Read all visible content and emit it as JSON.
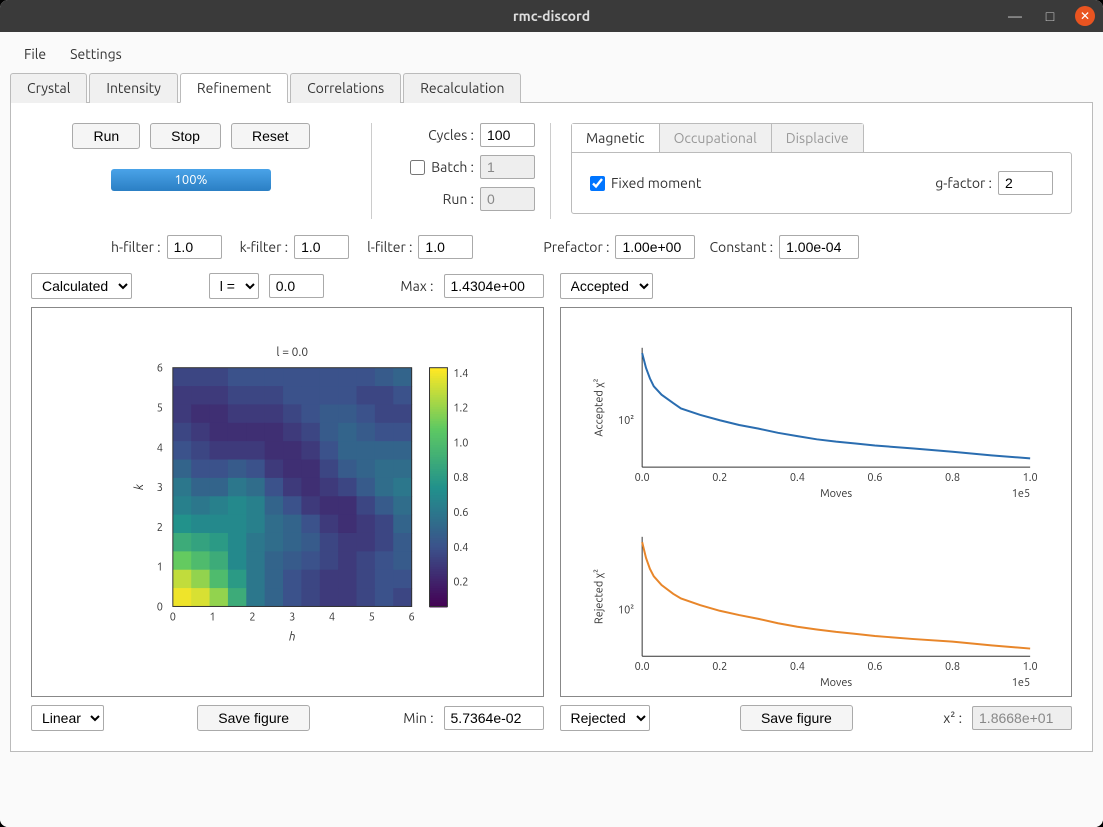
{
  "window": {
    "title": "rmc-discord"
  },
  "menu": {
    "file": "File",
    "settings": "Settings"
  },
  "tabs": [
    "Crystal",
    "Intensity",
    "Refinement",
    "Correlations",
    "Recalculation"
  ],
  "active_tab": "Refinement",
  "buttons": {
    "run": "Run",
    "stop": "Stop",
    "reset": "Reset"
  },
  "progress": "100%",
  "cycles": {
    "label": "Cycles :",
    "value": "100"
  },
  "batch": {
    "label": "Batch :",
    "value": "1",
    "checked": false
  },
  "run_field": {
    "label": "Run :",
    "value": "0"
  },
  "inner_tabs": {
    "magnetic": "Magnetic",
    "occupational": "Occupational",
    "displacive": "Displacive"
  },
  "fixed_moment": {
    "label": "Fixed moment",
    "checked": true
  },
  "gfactor": {
    "label": "g-factor :",
    "value": "2"
  },
  "filters": {
    "h": {
      "label": "h-filter :",
      "value": "1.0"
    },
    "k": {
      "label": "k-filter :",
      "value": "1.0"
    },
    "l": {
      "label": "l-filter :",
      "value": "1.0"
    }
  },
  "prefactor": {
    "label": "Prefactor :",
    "value": "1.00e+00"
  },
  "constant": {
    "label": "Constant :",
    "value": "1.00e-04"
  },
  "left_plot": {
    "mode_select": "Calculated",
    "axis_select": "l =",
    "axis_value": "0.0",
    "max_label": "Max :",
    "max_value": "1.4304e+00",
    "scale_select": "Linear",
    "save_btn": "Save figure",
    "min_label": "Min :",
    "min_value": "5.7364e-02"
  },
  "right_plot": {
    "top_select": "Accepted",
    "bottom_select": "Rejected",
    "save_btn": "Save figure",
    "chi2_label": "x² :",
    "chi2_value": "1.8668e+01"
  },
  "chart_data": [
    {
      "type": "heatmap",
      "title": "l = 0.0",
      "xlabel": "h",
      "ylabel": "k",
      "xlim": [
        0,
        6
      ],
      "ylim": [
        0,
        6
      ],
      "colorbar_ticks": [
        0.2,
        0.4,
        0.6,
        0.8,
        1.0,
        1.2,
        1.4
      ],
      "grid": [
        [
          1.4,
          1.35,
          1.2,
          0.9,
          0.6,
          0.5,
          0.4,
          0.35,
          0.3,
          0.3,
          0.35,
          0.4,
          0.35
        ],
        [
          1.3,
          1.2,
          1.0,
          0.8,
          0.6,
          0.5,
          0.4,
          0.35,
          0.3,
          0.3,
          0.35,
          0.4,
          0.4
        ],
        [
          1.1,
          1.0,
          0.9,
          0.7,
          0.6,
          0.5,
          0.45,
          0.4,
          0.35,
          0.3,
          0.35,
          0.4,
          0.45
        ],
        [
          0.9,
          0.85,
          0.8,
          0.7,
          0.6,
          0.55,
          0.5,
          0.45,
          0.35,
          0.3,
          0.3,
          0.35,
          0.45
        ],
        [
          0.75,
          0.7,
          0.7,
          0.7,
          0.65,
          0.55,
          0.5,
          0.4,
          0.3,
          0.25,
          0.3,
          0.35,
          0.5
        ],
        [
          0.65,
          0.6,
          0.65,
          0.7,
          0.65,
          0.5,
          0.4,
          0.3,
          0.25,
          0.25,
          0.35,
          0.45,
          0.55
        ],
        [
          0.6,
          0.5,
          0.5,
          0.6,
          0.55,
          0.4,
          0.3,
          0.25,
          0.3,
          0.35,
          0.45,
          0.55,
          0.6
        ],
        [
          0.5,
          0.4,
          0.4,
          0.45,
          0.4,
          0.3,
          0.25,
          0.25,
          0.35,
          0.45,
          0.5,
          0.55,
          0.55
        ],
        [
          0.4,
          0.35,
          0.3,
          0.3,
          0.3,
          0.25,
          0.25,
          0.3,
          0.4,
          0.5,
          0.5,
          0.5,
          0.5
        ],
        [
          0.35,
          0.3,
          0.25,
          0.25,
          0.25,
          0.25,
          0.3,
          0.35,
          0.45,
          0.5,
          0.45,
          0.4,
          0.4
        ],
        [
          0.3,
          0.25,
          0.25,
          0.3,
          0.3,
          0.3,
          0.35,
          0.4,
          0.45,
          0.45,
          0.4,
          0.35,
          0.35
        ],
        [
          0.3,
          0.3,
          0.3,
          0.35,
          0.35,
          0.35,
          0.4,
          0.4,
          0.4,
          0.4,
          0.35,
          0.35,
          0.4
        ],
        [
          0.35,
          0.35,
          0.35,
          0.4,
          0.4,
          0.4,
          0.4,
          0.4,
          0.4,
          0.4,
          0.4,
          0.45,
          0.5
        ]
      ]
    },
    {
      "type": "line",
      "title": "",
      "xlabel": "Moves",
      "ylabel": "Accepted χ²",
      "xlim": [
        0,
        1.0
      ],
      "xscale": "1e5",
      "yscale": "log",
      "x_ticks": [
        0.0,
        0.2,
        0.4,
        0.6,
        0.8,
        1.0
      ],
      "y_ticks": [
        100
      ],
      "series": [
        {
          "name": "Accepted",
          "color": "#2a6db0",
          "x": [
            0.0,
            0.01,
            0.02,
            0.03,
            0.05,
            0.08,
            0.1,
            0.15,
            0.2,
            0.25,
            0.3,
            0.35,
            0.4,
            0.45,
            0.5,
            0.55,
            0.6,
            0.7,
            0.8,
            0.9,
            1.0
          ],
          "y": [
            1000,
            600,
            420,
            320,
            240,
            180,
            150,
            120,
            100,
            85,
            75,
            65,
            58,
            52,
            48,
            45,
            42,
            38,
            34,
            30,
            27
          ]
        }
      ]
    },
    {
      "type": "line",
      "title": "",
      "xlabel": "Moves",
      "ylabel": "Rejected χ²",
      "xlim": [
        0,
        1.0
      ],
      "xscale": "1e5",
      "yscale": "log",
      "x_ticks": [
        0.0,
        0.2,
        0.4,
        0.6,
        0.8,
        1.0
      ],
      "y_ticks": [
        100
      ],
      "series": [
        {
          "name": "Rejected",
          "color": "#e8862a",
          "x": [
            0.0,
            0.01,
            0.02,
            0.03,
            0.05,
            0.08,
            0.1,
            0.15,
            0.2,
            0.25,
            0.3,
            0.35,
            0.4,
            0.45,
            0.5,
            0.55,
            0.6,
            0.7,
            0.8,
            0.9,
            1.0
          ],
          "y": [
            1000,
            580,
            400,
            310,
            230,
            170,
            145,
            115,
            95,
            82,
            72,
            62,
            55,
            50,
            46,
            43,
            40,
            36,
            33,
            29,
            26
          ]
        }
      ]
    }
  ]
}
